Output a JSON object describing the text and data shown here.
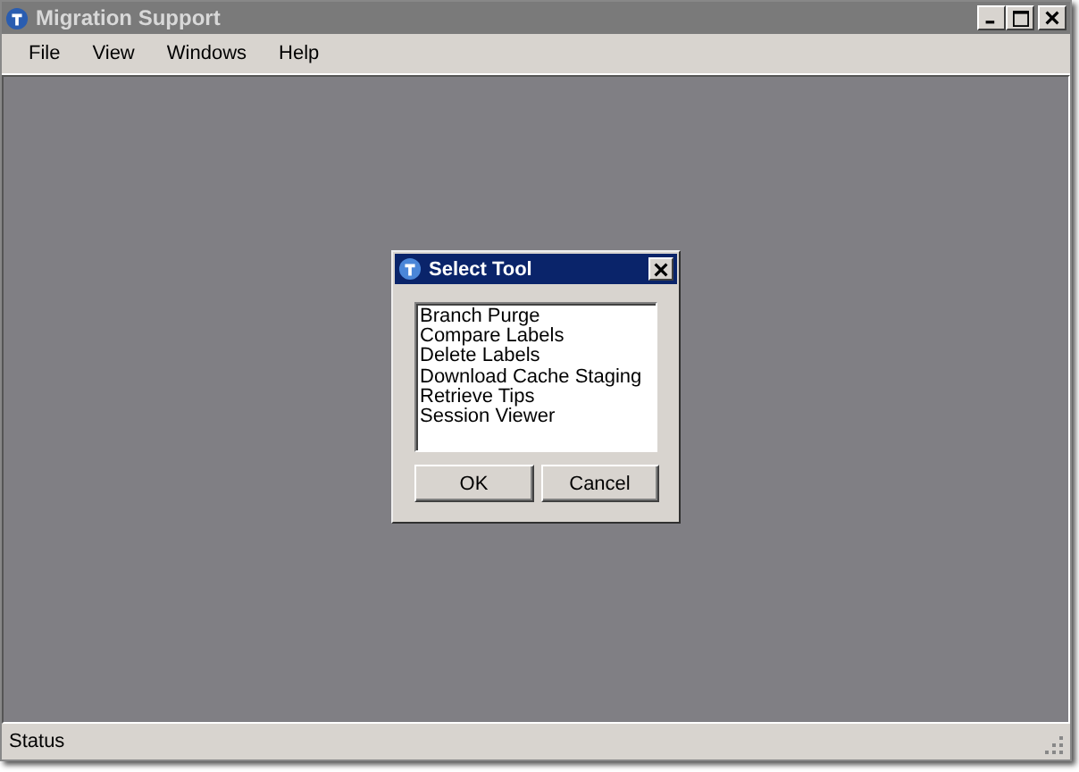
{
  "window": {
    "title": "Migration Support"
  },
  "menu": [
    "File",
    "View",
    "Windows",
    "Help"
  ],
  "dialog": {
    "title": "Select Tool",
    "items": [
      {
        "label": "Branch Purge"
      },
      {
        "label": "Compare Labels"
      },
      {
        "label": "Delete Labels"
      },
      {
        "label": "Download Cache Staging"
      },
      {
        "label": "Retrieve Tips"
      },
      {
        "label": "Session Viewer"
      }
    ],
    "buttons": [
      "OK",
      "Cancel"
    ]
  },
  "status_bar": "Status"
}
